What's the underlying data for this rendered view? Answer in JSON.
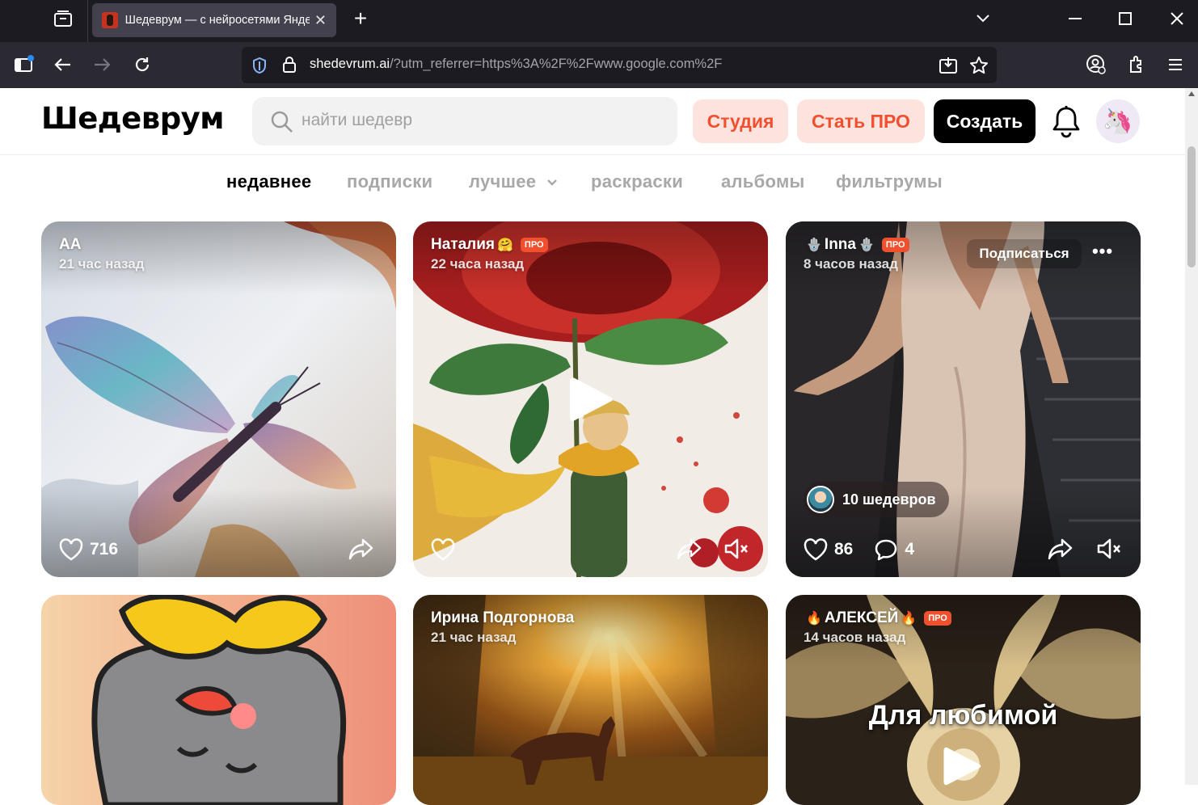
{
  "browser": {
    "tab_title": "Шедеврум — с нейросетями Янде",
    "url_main": "shedevrum.ai",
    "url_rest": "/?utm_referrer=https%3A%2F%2Fwww.google.com%2F"
  },
  "header": {
    "logo": "Шедеврум",
    "search_placeholder": "найти шедевр",
    "studio_label": "Студия",
    "pro_label": "Стать ПРО",
    "create_label": "Создать"
  },
  "filters": [
    "недавнее",
    "подписки",
    "лучшее",
    "раскраски",
    "альбомы",
    "фильтрумы"
  ],
  "cards": [
    {
      "author": "АА",
      "time": "21 час назад",
      "likes": "716"
    },
    {
      "author": "Наталия",
      "emoji": "🤗",
      "pro": "ПРО",
      "time": "22 часа назад"
    },
    {
      "author": "Inna",
      "emoji": "🪬",
      "pro": "ПРО",
      "time": "8 часов назад",
      "subscribe": "Подписаться",
      "more": "•••",
      "collection": "10 шедевров",
      "likes": "86",
      "comments": "4"
    },
    {
      "author": "",
      "time": ""
    },
    {
      "author": "Ирина Подгорнова",
      "time": "21 час назад"
    },
    {
      "author": "АЛЕКСЕЙ",
      "emoji": "🔥",
      "pro": "ПРО",
      "time": "14 часов назад",
      "overlay_text": "Для любимой"
    }
  ],
  "colors": {
    "accent": "#f1502f",
    "pill_bg": "#fde3de",
    "chrome_dark": "#1c1b22",
    "chrome": "#2b2a33"
  }
}
